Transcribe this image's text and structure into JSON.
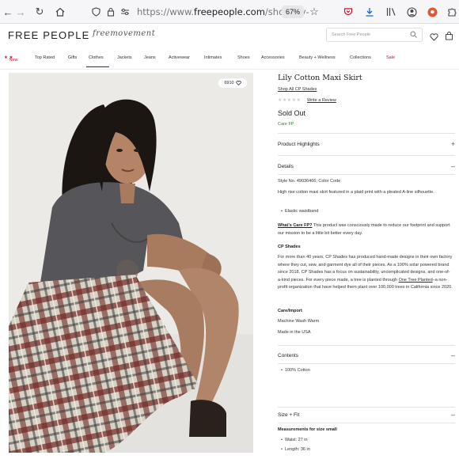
{
  "browser": {
    "url_prefix": "https://www.",
    "url_host": "freepeople.com",
    "url_path": "/shop/lily-",
    "zoom": "67%"
  },
  "site": {
    "logo": "FREE PEOPLE",
    "logo_script": "freemovement",
    "search_placeholder": "Search Free People"
  },
  "nav": {
    "items": [
      "New",
      "Top Rated",
      "Gifts",
      "Clothes",
      "Jackets",
      "Jeans",
      "Activewear",
      "Intimates",
      "Shoes",
      "Accessories",
      "Beauty + Wellness",
      "Collections",
      "Sale"
    ]
  },
  "product": {
    "likes": "6910",
    "title": "Lily Cotton Maxi Skirt",
    "shop_all": "Shop All CP Shades",
    "write_review": "Write a Review",
    "rating_stars": 0,
    "availability": "Sold Out",
    "care_fp": "Care FP"
  },
  "sections": {
    "highlights": "Product Highlights",
    "details": "Details",
    "contents": "Contents",
    "size_fit": "Size + Fit"
  },
  "details": {
    "style_no": "Style No. 49036466; Color Code:",
    "description": "High rise cotton maxi skirt featured in a plaid print with a pleated A-line silhouette.",
    "bullet": "Elastic waistband",
    "care_heading": "What's Care FP?",
    "care_text": "This product was consciously made to reduce our footprint and support our mission to be a little bit better every day.",
    "brand_heading": "CP Shades",
    "brand_text_1": "For more than 40 years, CP Shades has produced hand-made designs in their own factory where they cut, sew, and garment dye all of their pieces. As a 100% solar powered brand since 2018, CP Shades has a focus on sustainability, uncomplicated designs, and one-of-a-kind pieces. For every piece made, a tree is planted through",
    "brand_link": "One Tree Planted",
    "brand_text_2": "–a non-profit organization that have helped them plant over 100,000 trees in California since 2020.",
    "care_import_heading": "Care/Import",
    "wash": "Machine Wash Warm",
    "made_in": "Made in the USA"
  },
  "contents": {
    "bullet": "100% Cotton"
  },
  "size_fit": {
    "heading": "Measurements for size small",
    "waist": "Waist: 27 in",
    "length": "Length: 36 in"
  },
  "colors": {
    "sale": "#c8102e",
    "new_star": "#c8102e",
    "care_green": "#3a7a3a"
  }
}
